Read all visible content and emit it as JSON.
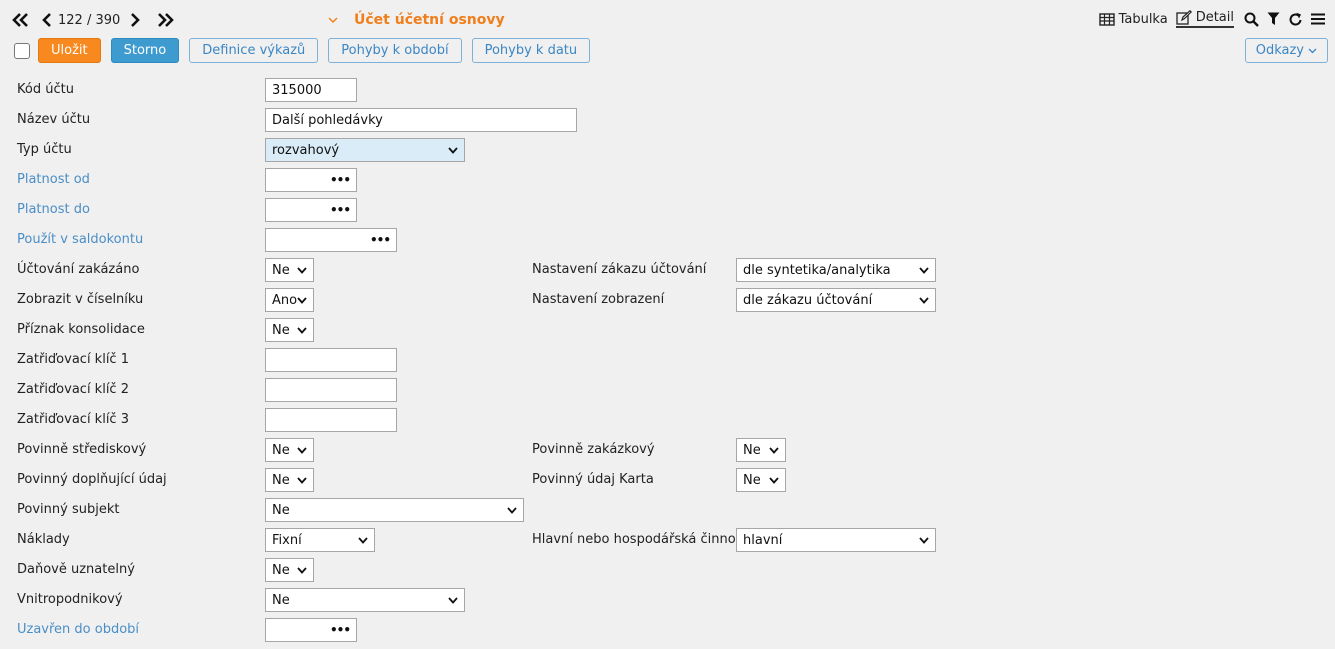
{
  "nav": {
    "counter": "122 / 390"
  },
  "header": {
    "title": "Účet účetní osnovy"
  },
  "views": {
    "table_label": "Tabulka",
    "detail_label": "Detail"
  },
  "toolbar": {
    "save_label": "Uložit",
    "cancel_label": "Storno",
    "report_def_label": "Definice výkazů",
    "period_moves_label": "Pohyby k období",
    "date_moves_label": "Pohyby k datu",
    "links_label": "Odkazy"
  },
  "form": {
    "account_code": {
      "label": "Kód účtu",
      "value": "315000"
    },
    "account_name": {
      "label": "Název účtu",
      "value": "Další pohledávky"
    },
    "account_type": {
      "label": "Typ účtu",
      "value": "rozvahový"
    },
    "valid_from": {
      "label": "Platnost od",
      "value": ""
    },
    "valid_to": {
      "label": "Platnost do",
      "value": ""
    },
    "saldo_use": {
      "label": "Použít v saldokontu",
      "value": ""
    },
    "posting_forbidden": {
      "label": "Účtování zakázáno",
      "value": "Ne"
    },
    "posting_ban_setting": {
      "label": "Nastavení zákazu účtování",
      "value": "dle syntetika/analytika"
    },
    "show_in_list": {
      "label": "Zobrazit v číselníku",
      "value": "Ano"
    },
    "display_setting": {
      "label": "Nastavení zobrazení",
      "value": "dle zákazu účtování"
    },
    "consolidation_flag": {
      "label": "Příznak konsolidace",
      "value": "Ne"
    },
    "class_key_1": {
      "label": "Zatřiďovací klíč 1",
      "value": ""
    },
    "class_key_2": {
      "label": "Zatřiďovací klíč 2",
      "value": ""
    },
    "class_key_3": {
      "label": "Zatřiďovací klíč 3",
      "value": ""
    },
    "mandatory_center": {
      "label": "Povinně střediskový",
      "value": "Ne"
    },
    "mandatory_order": {
      "label": "Povinně zakázkový",
      "value": "Ne"
    },
    "mandatory_extra": {
      "label": "Povinný doplňující údaj",
      "value": "Ne"
    },
    "mandatory_card": {
      "label": "Povinný údaj Karta",
      "value": "Ne"
    },
    "mandatory_subject": {
      "label": "Povinný subjekt",
      "value": "Ne"
    },
    "costs": {
      "label": "Náklady",
      "value": "Fixní"
    },
    "main_activity": {
      "label": "Hlavní nebo hospodářská činnost",
      "value": "hlavní"
    },
    "tax_deductible": {
      "label": "Daňově uznatelný",
      "value": "Ne"
    },
    "intracompany": {
      "label": "Vnitropodnikový",
      "value": "Ne"
    },
    "closed_to_period": {
      "label": "Uzavřen do období",
      "value": ""
    }
  },
  "colors": {
    "accent_orange": "#f07e1a",
    "primary_blue": "#3d9bd0",
    "link_blue": "#4a8ec6"
  }
}
